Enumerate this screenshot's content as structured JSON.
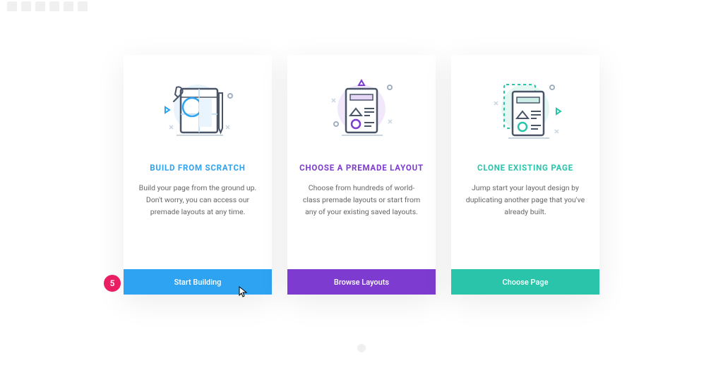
{
  "step_badge": "5",
  "cards": [
    {
      "title": "BUILD FROM SCRATCH",
      "desc": "Build your page from the ground up. Don't worry, you can access our premade layouts at any time.",
      "button": "Start Building"
    },
    {
      "title": "CHOOSE A PREMADE LAYOUT",
      "desc": "Choose from hundreds of world-class premade layouts or start from any of your existing saved layouts.",
      "button": "Browse Layouts"
    },
    {
      "title": "CLONE EXISTING PAGE",
      "desc": "Jump start your layout design by duplicating another page that you've already built.",
      "button": "Choose Page"
    }
  ]
}
